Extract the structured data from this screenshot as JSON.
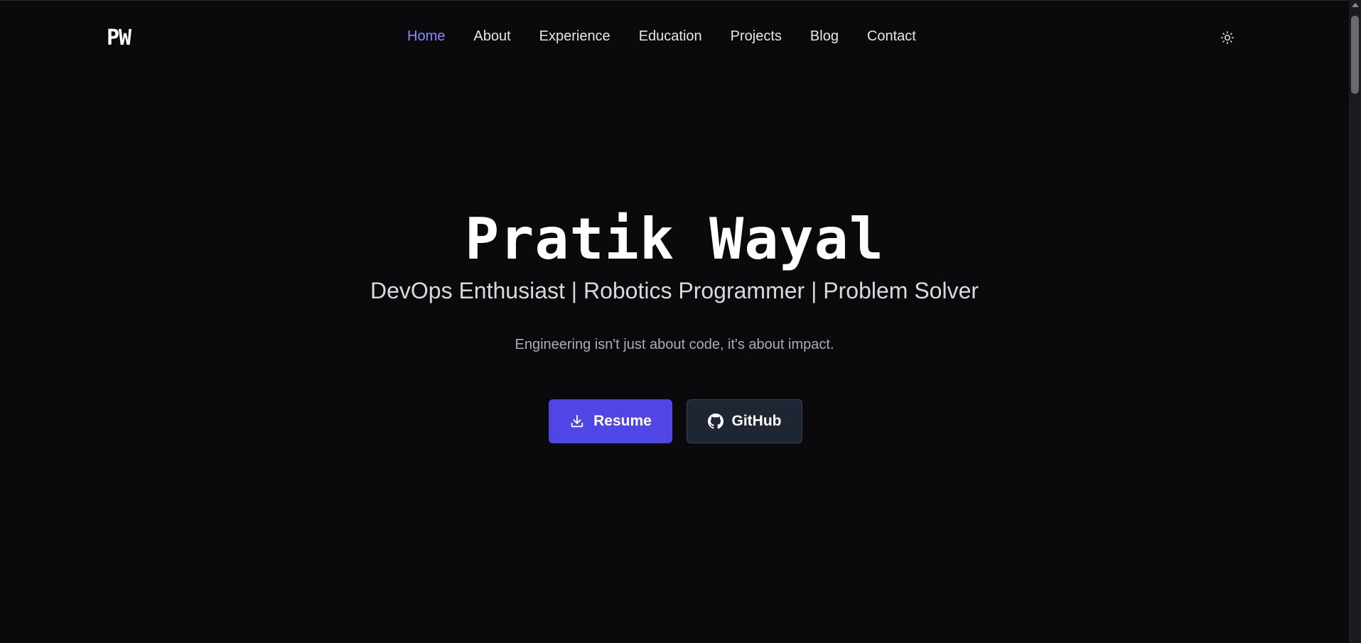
{
  "nav": {
    "logo": "PW",
    "links": [
      {
        "label": "Home",
        "active": true
      },
      {
        "label": "About",
        "active": false
      },
      {
        "label": "Experience",
        "active": false
      },
      {
        "label": "Education",
        "active": false
      },
      {
        "label": "Projects",
        "active": false
      },
      {
        "label": "Blog",
        "active": false
      },
      {
        "label": "Contact",
        "active": false
      }
    ],
    "theme_toggle_icon": "sun-icon"
  },
  "hero": {
    "name": "Pratik Wayal",
    "tagline": "DevOps Enthusiast | Robotics Programmer | Problem Solver",
    "motto": "Engineering isn't just about code, it's about impact.",
    "buttons": {
      "resume_label": "Resume",
      "resume_icon": "download-icon",
      "github_label": "GitHub",
      "github_icon": "github-icon"
    }
  },
  "colors": {
    "background": "#0a0a0c",
    "accent": "#4f46e5",
    "active_link": "#8b8cf8",
    "secondary_button": "#1f2633"
  }
}
